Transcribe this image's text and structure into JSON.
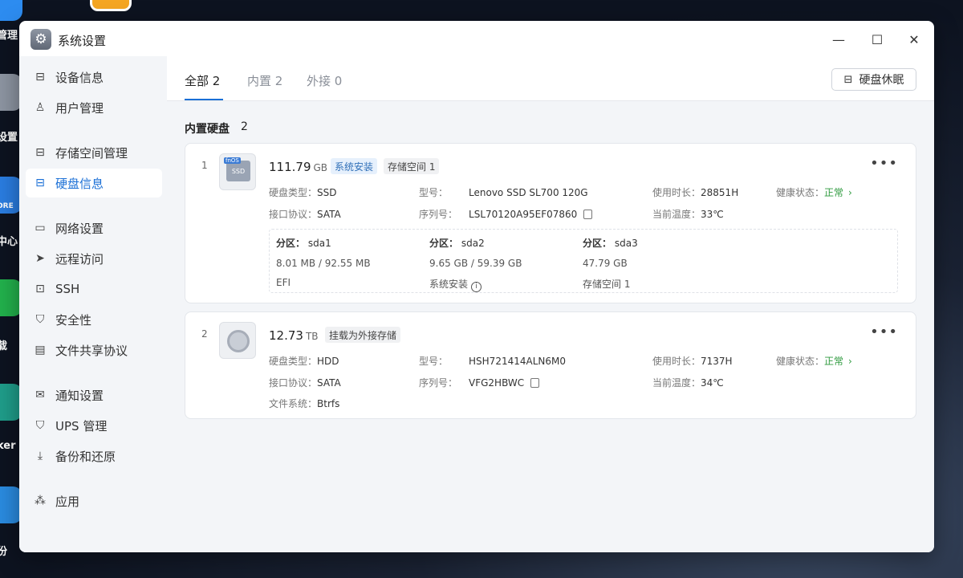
{
  "desktop": {
    "labels": [
      "管理",
      "设置",
      "中心",
      "载",
      "ker",
      "份"
    ],
    "store_label": "ORE"
  },
  "window": {
    "title": "系统设置",
    "controls": {
      "minimize": "—",
      "maximize": "☐",
      "close": "✕"
    }
  },
  "sidebar": {
    "items": [
      {
        "label": "设备信息",
        "icon": "disk-icon"
      },
      {
        "label": "用户管理",
        "icon": "user-icon"
      },
      {
        "label": "存储空间管理",
        "icon": "storage-icon"
      },
      {
        "label": "硬盘信息",
        "icon": "disk-icon",
        "active": true
      },
      {
        "label": "网络设置",
        "icon": "network-icon"
      },
      {
        "label": "远程访问",
        "icon": "send-icon"
      },
      {
        "label": "SSH",
        "icon": "terminal-icon"
      },
      {
        "label": "安全性",
        "icon": "shield-icon"
      },
      {
        "label": "文件共享协议",
        "icon": "file-icon"
      },
      {
        "label": "通知设置",
        "icon": "mail-icon"
      },
      {
        "label": "UPS 管理",
        "icon": "shield-icon"
      },
      {
        "label": "备份和还原",
        "icon": "backup-icon"
      },
      {
        "label": "应用",
        "icon": "apps-icon"
      }
    ]
  },
  "tabs": [
    {
      "label": "全部",
      "count": "2",
      "active": true
    },
    {
      "label": "内置",
      "count": "2"
    },
    {
      "label": "外接",
      "count": "0"
    }
  ],
  "toolbar": {
    "sleep_label": "硬盘休眠"
  },
  "section": {
    "title": "内置硬盘",
    "count": "2"
  },
  "disks": [
    {
      "index": "1",
      "size": "111.79",
      "unit": "GB",
      "badges": [
        "系统安装",
        "存储空间 1"
      ],
      "type_label": "硬盘类型：",
      "type": "SSD",
      "iface_label": "接口协议：",
      "iface": "SATA",
      "model_label": "型号：",
      "model": "Lenovo SSD SL700 120G",
      "serial_label": "序列号：",
      "serial": "LSL70120A95EF07860",
      "uptime_label": "使用时长：",
      "uptime": "28851H",
      "temp_label": "当前温度：",
      "temp": "33℃",
      "health_label": "健康状态：",
      "health": "正常",
      "partitions": [
        {
          "title": "分区：",
          "name": "sda1",
          "usage": "8.01 MB / 92.55 MB",
          "desc": "EFI"
        },
        {
          "title": "分区：",
          "name": "sda2",
          "usage": "9.65 GB / 59.39 GB",
          "desc": "系统安装"
        },
        {
          "title": "分区：",
          "name": "sda3",
          "usage": "47.79 GB",
          "desc": "存储空间 1"
        }
      ]
    },
    {
      "index": "2",
      "size": "12.73",
      "unit": "TB",
      "badges": [
        "挂载为外接存储"
      ],
      "type_label": "硬盘类型：",
      "type": "HDD",
      "iface_label": "接口协议：",
      "iface": "SATA",
      "fs_label": "文件系统：",
      "fs": "Btrfs",
      "model_label": "型号：",
      "model": "HSH721414ALN6M0",
      "serial_label": "序列号：",
      "serial": "VFG2HBWC",
      "uptime_label": "使用时长：",
      "uptime": "7137H",
      "temp_label": "当前温度：",
      "temp": "34℃",
      "health_label": "健康状态：",
      "health": "正常"
    }
  ],
  "colors": {
    "accent": "#1a6fd6",
    "ok": "#2e9a3e",
    "badge_blue_bg": "#e6f0fc"
  }
}
